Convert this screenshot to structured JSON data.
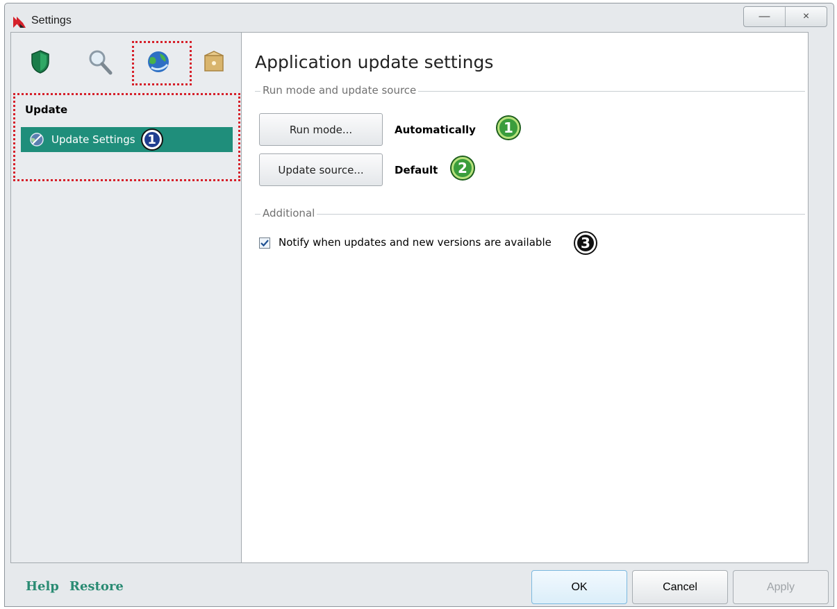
{
  "window": {
    "title": "Settings",
    "minimize_label": "—",
    "close_label": "×"
  },
  "sidebar": {
    "category_icons": [
      "shield-icon",
      "magnifier-icon",
      "globe-icon",
      "box-icon"
    ],
    "section_title": "Update",
    "items": [
      {
        "label": "Update Settings",
        "badge": "1",
        "icon": "update-globe-icon",
        "selected": true
      }
    ]
  },
  "main": {
    "title": "Application update settings",
    "groups": [
      {
        "label": "Run mode and update source",
        "rows": [
          {
            "button": "Run mode...",
            "value": "Automatically",
            "badge": "1"
          },
          {
            "button": "Update source...",
            "value": "Default",
            "badge": "2"
          }
        ]
      },
      {
        "label": "Additional",
        "checkbox": {
          "label": "Notify when updates and new versions are available",
          "checked": true,
          "badge": "3"
        }
      }
    ]
  },
  "footer": {
    "help": "Help",
    "restore": "Restore",
    "ok": "OK",
    "cancel": "Cancel",
    "apply": "Apply"
  },
  "colors": {
    "accent": "#1f8e7b",
    "highlight_dash": "#d6202a",
    "link": "#2a8b73"
  }
}
